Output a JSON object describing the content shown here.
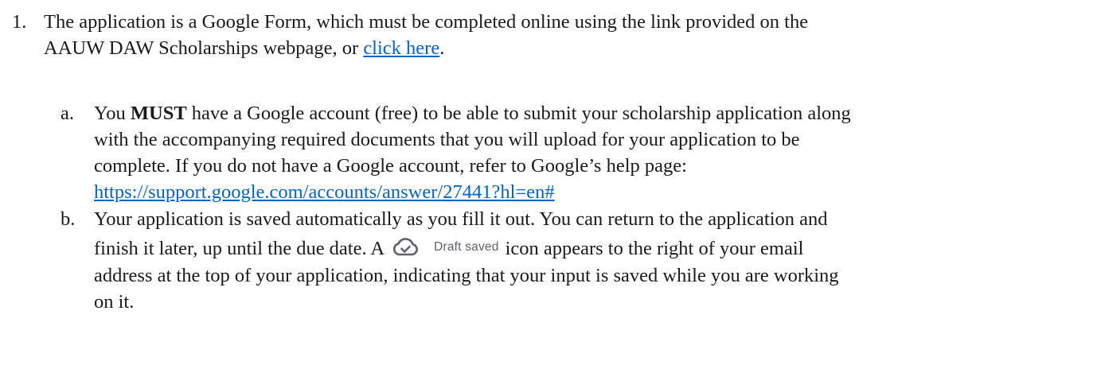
{
  "item1": {
    "number": "1.",
    "line1": "The application is a Google Form, which must be completed online using the link provided on the",
    "line2_prefix": "AAUW DAW Scholarships webpage, or ",
    "link_text": "click here",
    "line2_suffix": "."
  },
  "item_a": {
    "letter": "a.",
    "line1_prefix": "You ",
    "must": "MUST",
    "line1_suffix": " have a Google account (free) to be able to submit your scholarship application along",
    "line2": "with the accompanying required documents that you will upload for your application to be",
    "line3": "complete. If you do not have a Google account, refer to Google’s help page:",
    "url": "https://support.google.com/accounts/answer/27441?hl=en#"
  },
  "item_b": {
    "letter": "b.",
    "line1": "Your application is saved automatically as you fill it out. You can return to the application and",
    "line2_prefix": "finish it later, up until the due date. A",
    "draft_label": "Draft saved",
    "draft_icon": "cloud-check-icon",
    "line2_suffix": "icon appears to the right of your email",
    "line3": "address at the top of your application, indicating that your input is saved while you are working",
    "line4": "on it."
  }
}
